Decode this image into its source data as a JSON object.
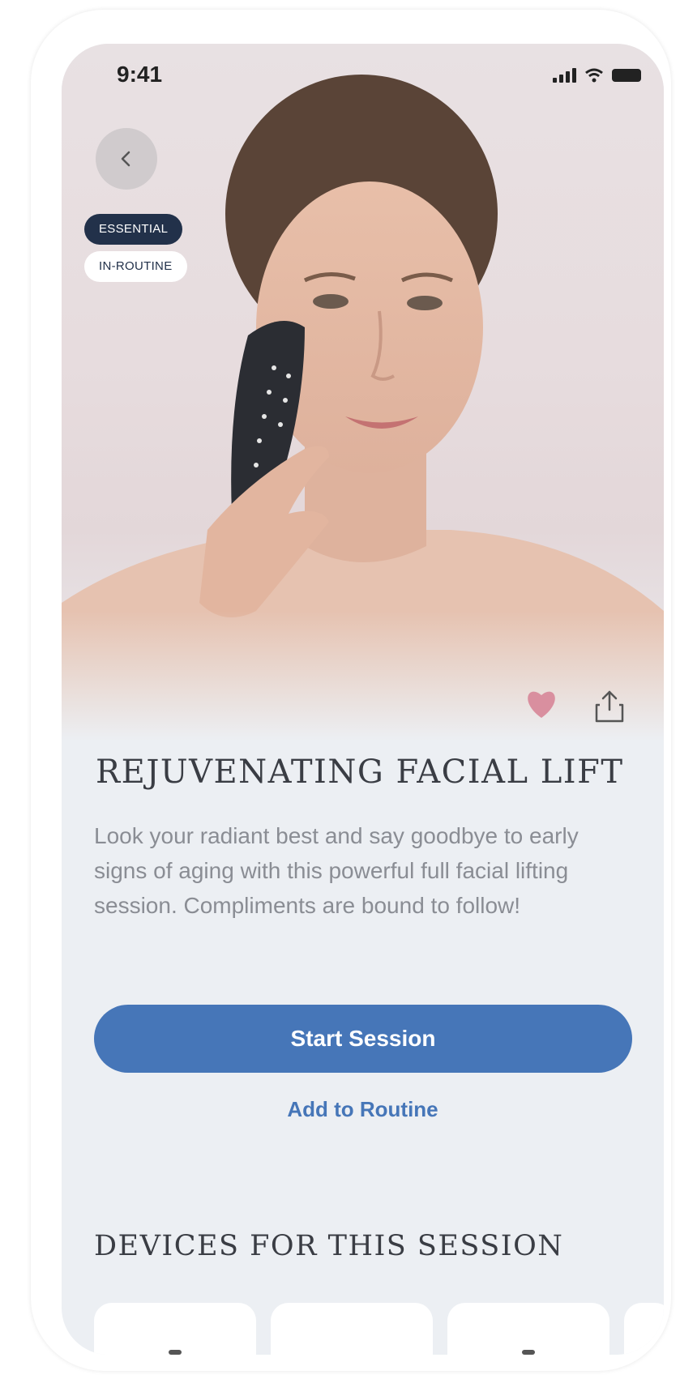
{
  "status_bar": {
    "time": "9:41"
  },
  "badges": {
    "essential": "ESSENTIAL",
    "routine": "IN-ROUTINE"
  },
  "session": {
    "title": "REJUVENATING FACIAL LIFT",
    "description": "Look your radiant best and say goodbye to early signs of aging with this powerful full facial lifting session. Compliments are bound to follow!"
  },
  "actions": {
    "start_label": "Start Session",
    "add_routine_label": "Add to Routine"
  },
  "devices": {
    "title": "DEVICES FOR THIS SESSION"
  },
  "icons": {
    "back": "chevron-left-icon",
    "favorite": "heart-icon",
    "share": "share-icon",
    "signal": "signal-icon",
    "wifi": "wifi-icon",
    "battery": "battery-icon"
  },
  "colors": {
    "primary": "#4676b8",
    "badge_dark": "#22314a",
    "heart": "#d98f9f",
    "title_text": "#3a3d44",
    "body_text": "#8a8d94",
    "background": "#eceff3"
  }
}
